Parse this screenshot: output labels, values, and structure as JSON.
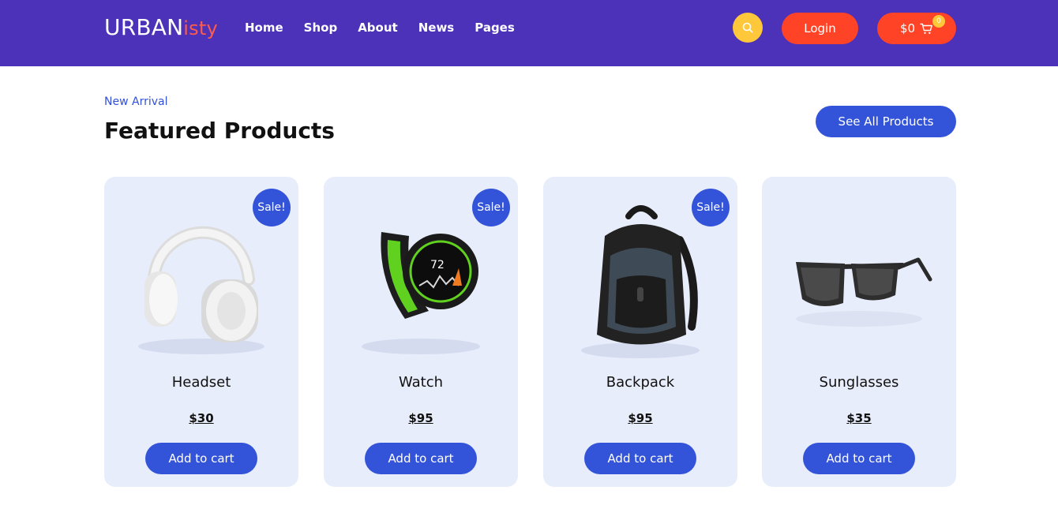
{
  "header": {
    "logo_main": "URBAN",
    "logo_accent": "isty",
    "nav": [
      {
        "label": "Home"
      },
      {
        "label": "Shop"
      },
      {
        "label": "About"
      },
      {
        "label": "News"
      },
      {
        "label": "Pages"
      }
    ],
    "login_label": "Login",
    "cart_total": "$0",
    "cart_count": "0",
    "search_icon": "search-icon",
    "cart_icon": "cart-icon"
  },
  "section": {
    "eyebrow": "New Arrival",
    "title": "Featured Products",
    "see_all_label": "See All Products"
  },
  "products": [
    {
      "name": "Headset",
      "price": "$30",
      "badge": "Sale!",
      "button": "Add to cart",
      "icon": "headset-image"
    },
    {
      "name": "Watch",
      "price": "$95",
      "badge": "Sale!",
      "button": "Add to cart",
      "icon": "watch-image"
    },
    {
      "name": "Backpack",
      "price": "$95",
      "badge": "Sale!",
      "button": "Add to cart",
      "icon": "backpack-image"
    },
    {
      "name": "Sunglasses",
      "price": "$35",
      "badge": "",
      "button": "Add to cart",
      "icon": "sunglasses-image"
    }
  ],
  "colors": {
    "header_bg": "#4b32b8",
    "accent_red": "#ff4326",
    "accent_yellow": "#ffc83a",
    "primary_blue": "#3354d9",
    "card_bg": "#e8edfb"
  }
}
